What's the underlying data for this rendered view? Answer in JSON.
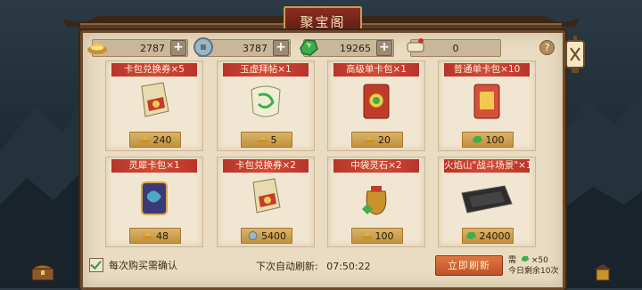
{
  "title": "聚宝阁",
  "currencies": [
    {
      "icon": "gold-ingot-icon",
      "value": "2787"
    },
    {
      "icon": "silver-coin-icon",
      "value": "3787"
    },
    {
      "icon": "jade-stone-icon",
      "value": "19265"
    },
    {
      "icon": "scroll-token-icon",
      "value": "0"
    }
  ],
  "items": [
    {
      "title": "卡包兑换券×5",
      "price": "240",
      "currency": "gold"
    },
    {
      "title": "玉虚拜帖×1",
      "price": "5",
      "currency": "gold"
    },
    {
      "title": "高级单卡包×1",
      "price": "20",
      "currency": "gold"
    },
    {
      "title": "普通单卡包×10",
      "price": "100",
      "currency": "jade"
    },
    {
      "title": "灵犀卡包×1",
      "price": "48",
      "currency": "gold"
    },
    {
      "title": "卡包兑换券×2",
      "price": "5400",
      "currency": "silver"
    },
    {
      "title": "中袋灵石×2",
      "price": "100",
      "currency": "gold"
    },
    {
      "title": "火焰山\"战斗场景\"×1",
      "price": "24000",
      "currency": "jade"
    }
  ],
  "footer": {
    "confirm_label": "每次购买需确认",
    "refresh_prefix": "下次自动刷新:",
    "refresh_time": "07:50:22",
    "refresh_button": "立即刷新",
    "cost_need": "需",
    "cost_amount": "×50",
    "remaining": "今日剩余10次"
  },
  "help_label": "?",
  "colors": {
    "accent_red": "#b8342a",
    "gold_plate": "#d9b36a",
    "parchment": "#e9dcc2"
  }
}
